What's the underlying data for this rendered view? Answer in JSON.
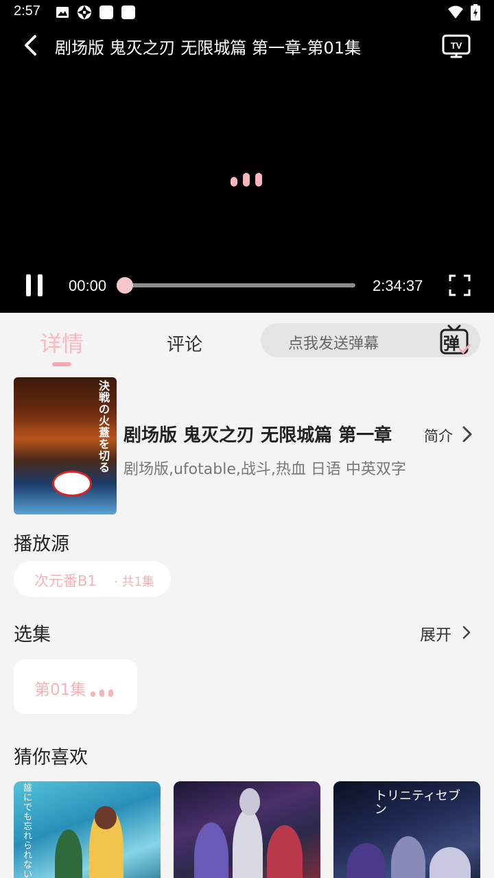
{
  "status": {
    "time": "2:57",
    "left_icons": [
      "image-icon",
      "aperture-icon",
      "square-app-icon",
      "square-app-icon"
    ],
    "right_icons": [
      "wifi-icon",
      "battery-icon"
    ]
  },
  "player": {
    "title": "剧场版 鬼灭之刃 无限城篇 第一章-第01集",
    "current_time": "00:00",
    "total_time": "2:34:37",
    "progress": 0,
    "state": "paused",
    "accent": "#f7b7bd"
  },
  "tabs": {
    "detail": "详情",
    "comments": "评论",
    "active": "detail"
  },
  "danmaku": {
    "placeholder": "点我发送弹幕",
    "icon_char": "弹"
  },
  "show": {
    "title": "剧场版 鬼灭之刃 无限城篇 第一章",
    "intro_label": "简介",
    "tags": "剧场版,ufotable,战斗,热血 日语 中英双字",
    "poster_text": "決戦の火蓋を切る"
  },
  "sources": {
    "heading": "播放源",
    "items": [
      {
        "name": "次元番B1",
        "count": "· 共1集"
      }
    ]
  },
  "episodes": {
    "heading": "选集",
    "expand_label": "展开",
    "items": [
      "第01集"
    ]
  },
  "recommend": {
    "heading": "猜你喜欢",
    "items": [
      {
        "poster_text": "誰にでも忘れられない夏がある"
      },
      {
        "poster_text": ""
      },
      {
        "poster_text": "トリニティセブン"
      }
    ]
  }
}
